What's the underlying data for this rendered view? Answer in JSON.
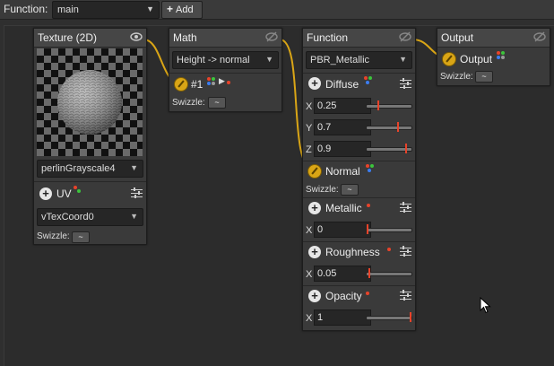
{
  "toolbar": {
    "function_label": "Function:",
    "function_value": "main",
    "add_label": "Add"
  },
  "nodes": {
    "texture": {
      "title": "Texture (2D)",
      "texture_select": "perlinGrayscale4",
      "uv_label": "UV",
      "uv_select": "vTexCoord0",
      "swizzle_label": "Swizzle:",
      "swizzle_value": "~"
    },
    "math": {
      "title": "Math",
      "op_select": "Height -> normal",
      "input_label": "#1",
      "swizzle_label": "Swizzle:",
      "swizzle_value": "~"
    },
    "function": {
      "title": "Function",
      "func_select": "PBR_Metallic",
      "diffuse": {
        "label": "Diffuse",
        "x": "0.25",
        "y": "0.7",
        "z": "0.9",
        "x_level": 0.25,
        "y_level": 0.7,
        "z_level": 0.9
      },
      "normal": {
        "label": "Normal",
        "swizzle_label": "Swizzle:",
        "swizzle_value": "~"
      },
      "metallic": {
        "label": "Metallic",
        "x": "0",
        "level": 0.0
      },
      "roughness": {
        "label": "Roughness",
        "x": "0.05",
        "level": 0.05
      },
      "opacity": {
        "label": "Opacity",
        "x": "1",
        "level": 1.0
      },
      "axis_x": "X",
      "axis_y": "Y",
      "axis_z": "Z"
    },
    "output": {
      "title": "Output",
      "input_label": "Output",
      "swizzle_label": "Swizzle:",
      "swizzle_value": "~"
    }
  },
  "colors": {
    "wire": "#d9a516",
    "accent_handle": "#e8432a",
    "dot_red": "#e8432a",
    "dot_green": "#3cc43c",
    "dot_blue": "#3c7df0"
  }
}
